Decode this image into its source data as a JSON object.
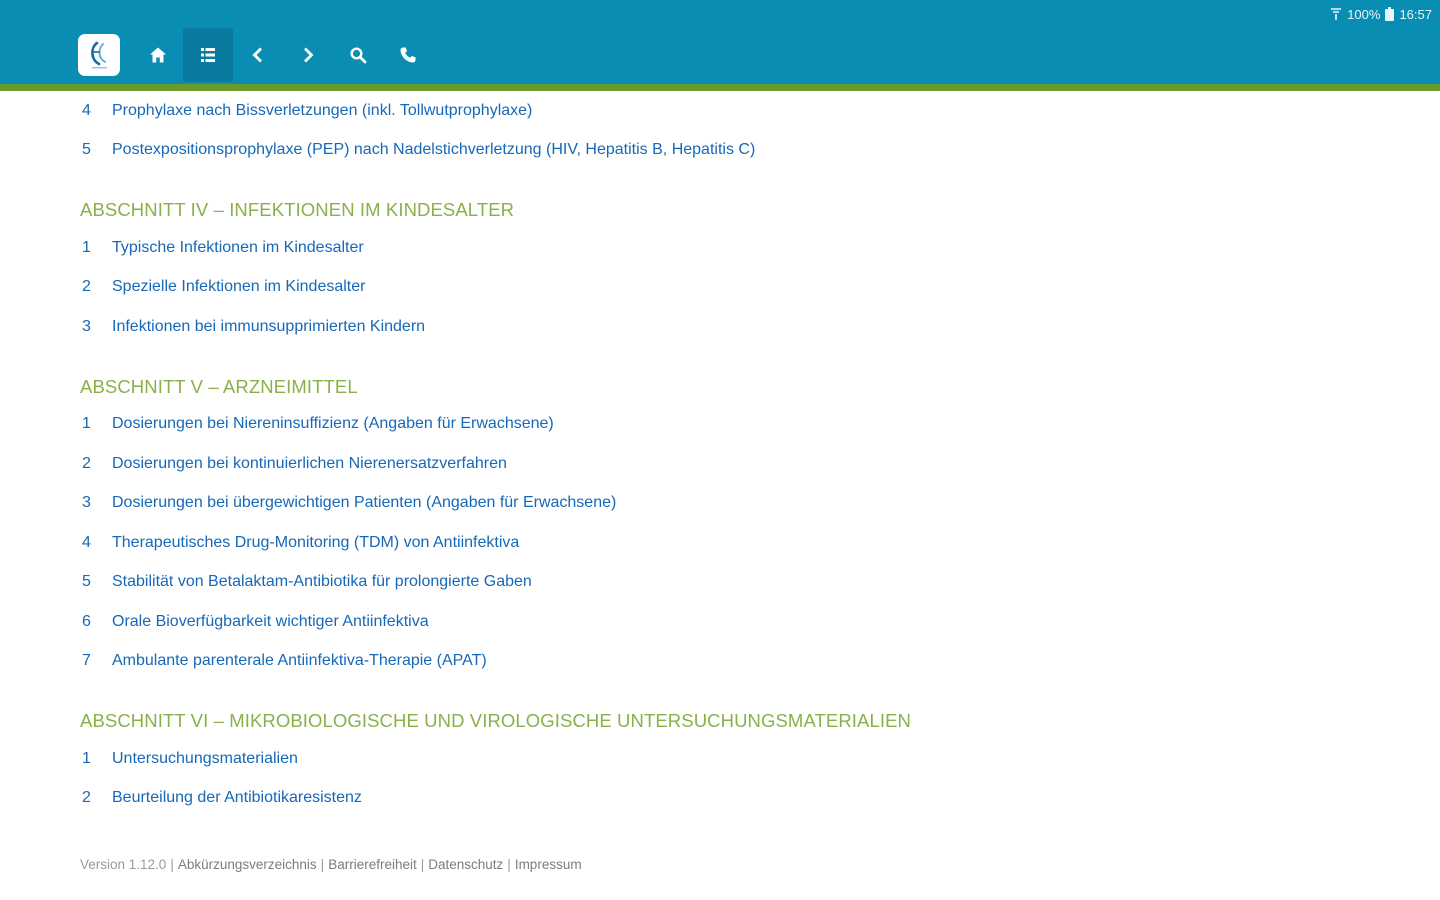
{
  "status_bar": {
    "battery": "100%",
    "time": "16:57"
  },
  "toolbar": {
    "buttons": [
      {
        "icon": "home-icon"
      },
      {
        "icon": "list-icon",
        "active": true
      },
      {
        "icon": "chevron-left-icon"
      },
      {
        "icon": "chevron-right-icon"
      },
      {
        "icon": "search-icon"
      },
      {
        "icon": "phone-icon"
      }
    ],
    "colors": {
      "bar": "#0a8db3",
      "active": "#0a7aa0",
      "rule": "#6a9a2a"
    }
  },
  "toc": {
    "lead_items": [
      {
        "number": "4",
        "title": "Prophylaxe nach Bissverletzungen (inkl. Tollwutprophylaxe)"
      },
      {
        "number": "5",
        "title": "Postexpositionsprophylaxe (PEP) nach Nadelstichverletzung (HIV, Hepatitis B, Hepatitis C)"
      }
    ],
    "sections": [
      {
        "heading": "ABSCHNITT IV – INFEKTIONEN IM KINDESALTER",
        "items": [
          {
            "number": "1",
            "title": "Typische Infektionen im Kindesalter"
          },
          {
            "number": "2",
            "title": "Spezielle Infektionen im Kindesalter"
          },
          {
            "number": "3",
            "title": "Infektionen bei immunsupprimierten Kindern"
          }
        ]
      },
      {
        "heading": "ABSCHNITT V – ARZNEIMITTEL",
        "items": [
          {
            "number": "1",
            "title": "Dosierungen bei Niereninsuffizienz (Angaben für Erwachsene)"
          },
          {
            "number": "2",
            "title": "Dosierungen bei kontinuierlichen Nierenersatzverfahren"
          },
          {
            "number": "3",
            "title": "Dosierungen bei übergewichtigen Patienten (Angaben für Erwachsene)"
          },
          {
            "number": "4",
            "title": "Therapeutisches Drug-Monitoring (TDM) von Antiinfektiva"
          },
          {
            "number": "5",
            "title": "Stabilität von Betalaktam-Antibiotika für prolongierte Gaben"
          },
          {
            "number": "6",
            "title": "Orale Bioverfügbarkeit wichtiger Antiinfektiva"
          },
          {
            "number": "7",
            "title": "Ambulante parenterale Antiinfektiva-Therapie (APAT)"
          }
        ]
      },
      {
        "heading": "ABSCHNITT VI – MIKROBIOLOGISCHE UND VIROLOGISCHE UNTERSUCHUNGSMATERIALIEN",
        "items": [
          {
            "number": "1",
            "title": "Untersuchungsmaterialien"
          },
          {
            "number": "2",
            "title": "Beurteilung der Antibiotikaresistenz"
          }
        ]
      }
    ],
    "colors": {
      "link": "#1668b8",
      "heading": "#8bb04a"
    }
  },
  "footer": {
    "version": "Version 1.12.0",
    "links": [
      "Abkürzungsverzeichnis",
      "Barrierefreiheit",
      "Datenschutz",
      "Impressum"
    ]
  }
}
